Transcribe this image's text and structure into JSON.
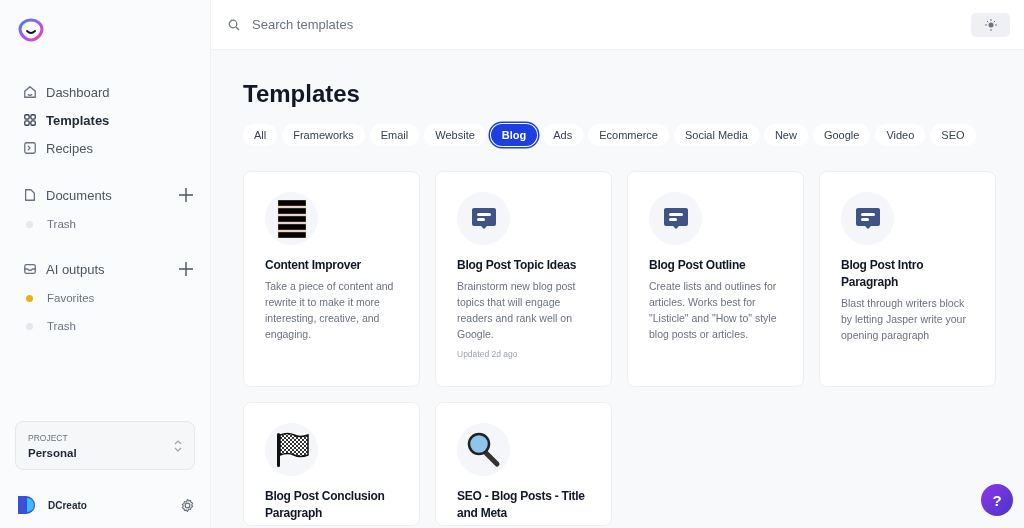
{
  "nav": [
    {
      "label": "Dashboard",
      "kind": "home",
      "selected": false
    },
    {
      "label": "Templates",
      "kind": "grid",
      "selected": true
    },
    {
      "label": "Recipes",
      "kind": "terminal",
      "selected": false
    }
  ],
  "sections": [
    {
      "label": "Documents",
      "kind": "file",
      "items": [
        {
          "label": "Trash",
          "color": "#e5e8ee"
        }
      ]
    },
    {
      "label": "AI outputs",
      "kind": "inbox",
      "items": [
        {
          "label": "Favorites",
          "color": "#eab308"
        },
        {
          "label": "Trash",
          "color": "#e5e8ee"
        }
      ]
    }
  ],
  "project": {
    "label": "PROJECT",
    "value": "Personal"
  },
  "user": {
    "name": "DCreato"
  },
  "search": {
    "placeholder": "Search templates"
  },
  "title": "Templates",
  "filters": [
    {
      "label": "All",
      "selected": false
    },
    {
      "label": "Frameworks",
      "selected": false
    },
    {
      "label": "Email",
      "selected": false
    },
    {
      "label": "Website",
      "selected": false
    },
    {
      "label": "Blog",
      "selected": true
    },
    {
      "label": "Ads",
      "selected": false
    },
    {
      "label": "Ecommerce",
      "selected": false
    },
    {
      "label": "Social Media",
      "selected": false
    },
    {
      "label": "New",
      "selected": false
    },
    {
      "label": "Google",
      "selected": false
    },
    {
      "label": "Video",
      "selected": false
    },
    {
      "label": "SEO",
      "selected": false
    }
  ],
  "cards": [
    {
      "kind": "lines",
      "title": "Content Improver",
      "description": "Take a piece of content and rewrite it to make it more interesting, creative, and engaging."
    },
    {
      "kind": "chat",
      "title": "Blog Post Topic Ideas",
      "description": "Brainstorm new blog post topics that will engage readers and rank well on Google.",
      "updated": "Updated 2d ago"
    },
    {
      "kind": "chat",
      "title": "Blog Post Outline",
      "description": "Create lists and outlines for articles. Works best for \"Listicle\" and \"How to\" style blog posts or articles."
    },
    {
      "kind": "chat",
      "title": "Blog Post Intro Paragraph",
      "description": "Blast through writers block by letting Jasper write your opening paragraph"
    },
    {
      "kind": "flag",
      "title": "Blog Post Conclusion Paragraph"
    },
    {
      "kind": "magnifier",
      "title": "SEO - Blog Posts - Title and Meta"
    }
  ],
  "help": {
    "label": "?"
  }
}
